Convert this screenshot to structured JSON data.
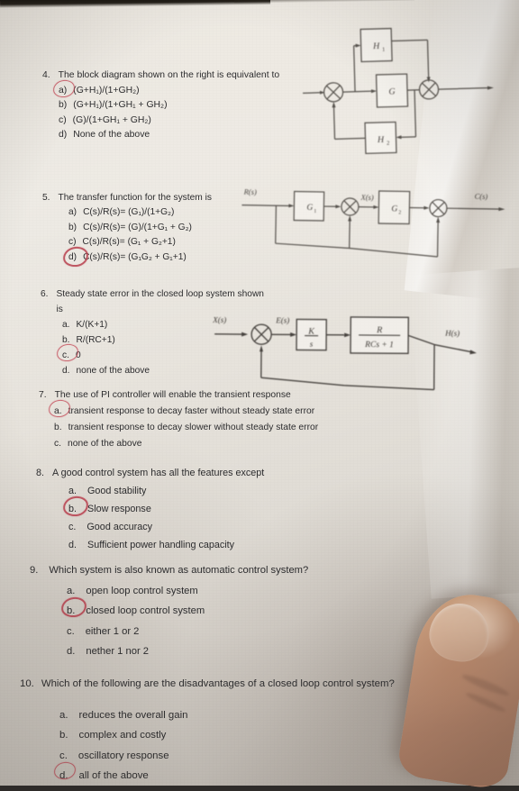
{
  "document": {
    "kind": "exam-answer-sheet-photo",
    "ink_circle_color": "#c44a58",
    "text_color": "#2c2c2e",
    "paper_color": "#e9e5dd"
  },
  "questions": [
    {
      "number": "4.",
      "text": "The block diagram shown on the right is equivalent to",
      "options": [
        {
          "label": "a)",
          "text": "(G+H₁)/(1+GH₂)",
          "circled": true
        },
        {
          "label": "b)",
          "text": "(G+H₁)/(1+GH₁ + GH₂)",
          "circled": false
        },
        {
          "label": "c)",
          "text": "(G)/(1+GH₁ + GH₂)",
          "circled": false
        },
        {
          "label": "d)",
          "text": "None of the above",
          "circled": false
        }
      ]
    },
    {
      "number": "5.",
      "text": "The transfer function for the system is",
      "options": [
        {
          "label": "a)",
          "text": "C(s)/R(s)= (G₁)/(1+G₂)",
          "circled": false
        },
        {
          "label": "b)",
          "text": "C(s)/R(s)= (G)/(1+G₁ + G₂)",
          "circled": false
        },
        {
          "label": "c)",
          "text": "C(s)/R(s)= (G₁ + G₂+1)",
          "circled": false
        },
        {
          "label": "d)",
          "text": "C(s)/R(s)= (G₁G₂ + G₁+1)",
          "circled": true
        }
      ]
    },
    {
      "number": "6.",
      "text": "Steady state error in the closed loop system shown is",
      "options": [
        {
          "label": "a.",
          "text": "K/(K+1)",
          "circled": false
        },
        {
          "label": "b.",
          "text": "R/(RC+1)",
          "circled": false
        },
        {
          "label": "c.",
          "text": "0",
          "circled": true
        },
        {
          "label": "d.",
          "text": "none of the above",
          "circled": false
        }
      ]
    },
    {
      "number": "7.",
      "text": "The use of PI controller will enable the transient response",
      "options": [
        {
          "label": "a.",
          "text": "transient response to decay faster without steady state error",
          "circled": true
        },
        {
          "label": "b.",
          "text": "transient response to decay slower without steady state error",
          "circled": false
        },
        {
          "label": "c.",
          "text": "none of the above",
          "circled": false
        }
      ]
    },
    {
      "number": "8.",
      "text": "A good control system has all the features except",
      "options": [
        {
          "label": "a.",
          "text": "Good stability",
          "circled": false
        },
        {
          "label": "b.",
          "text": "Slow response",
          "circled": true
        },
        {
          "label": "c.",
          "text": "Good accuracy",
          "circled": false
        },
        {
          "label": "d.",
          "text": "Sufficient power handling capacity",
          "circled": false
        }
      ]
    },
    {
      "number": "9.",
      "text": "Which system is also known as automatic control system?",
      "options": [
        {
          "label": "a.",
          "text": "open loop control system",
          "circled": false
        },
        {
          "label": "b.",
          "text": "closed loop control system",
          "circled": true
        },
        {
          "label": "c.",
          "text": "either 1 or 2",
          "circled": false
        },
        {
          "label": "d.",
          "text": "nether 1 nor 2",
          "circled": false
        }
      ]
    },
    {
      "number": "10.",
      "text": "Which of the following are the disadvantages of a closed loop control system?",
      "options": [
        {
          "label": "a.",
          "text": "reduces the overall gain",
          "circled": false
        },
        {
          "label": "b.",
          "text": "complex and costly",
          "circled": false
        },
        {
          "label": "c.",
          "text": "oscillatory response",
          "circled": false
        },
        {
          "label": "d.",
          "text": "all of the above",
          "circled": true
        }
      ]
    }
  ],
  "diagrams": [
    {
      "id": "diagram-q4",
      "for_question": "4.",
      "blocks": [
        "H₁",
        "G",
        "H₂"
      ],
      "summing_junctions": 2,
      "signals": []
    },
    {
      "id": "diagram-q5",
      "for_question": "5.",
      "blocks": [
        "G₁",
        "G₂"
      ],
      "summing_junctions": 2,
      "signals": [
        "R(s)",
        "X(s)",
        "C(s)"
      ]
    },
    {
      "id": "diagram-q6",
      "for_question": "6.",
      "blocks": [
        "K/s",
        "R/(RCs + 1)"
      ],
      "block_numerators": [
        "K",
        "R"
      ],
      "block_denominators": [
        "s",
        "RCs + 1"
      ],
      "summing_junctions": 1,
      "signals": [
        "X(s)",
        "E(s)",
        "H(s)"
      ]
    }
  ]
}
